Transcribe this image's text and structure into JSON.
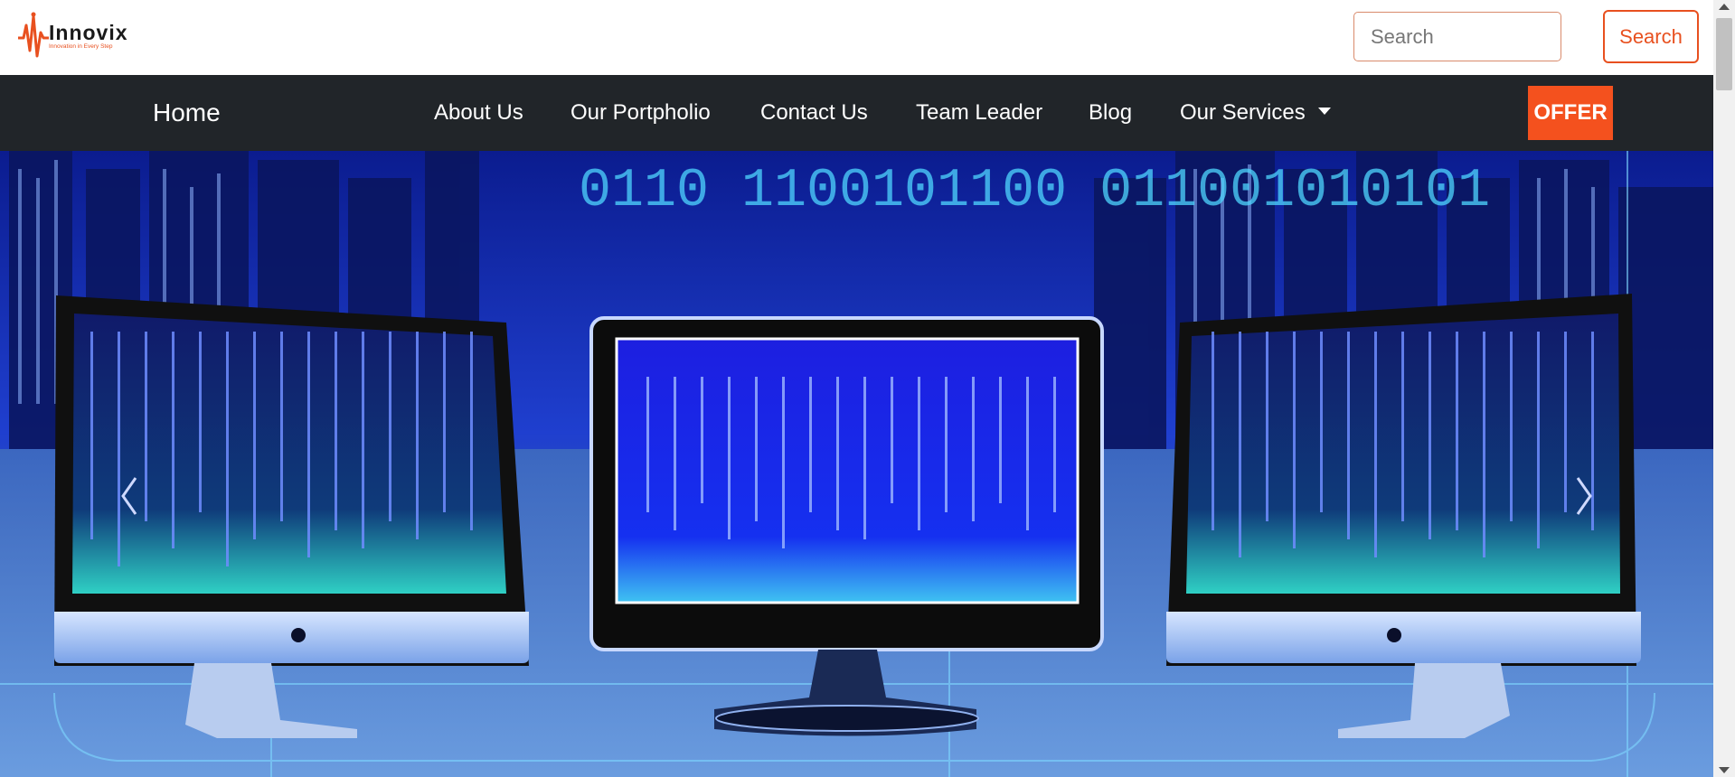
{
  "brand": {
    "name": "Innovix",
    "tagline": "Innovation in Every Step"
  },
  "search": {
    "placeholder": "Search",
    "button_label": "Search"
  },
  "nav": {
    "home": "Home",
    "items": [
      {
        "label": "About Us"
      },
      {
        "label": "Our Portpholio"
      },
      {
        "label": "Contact Us"
      },
      {
        "label": "Team Leader"
      },
      {
        "label": "Blog"
      },
      {
        "label": "Our Services"
      }
    ],
    "offer": "OFFER"
  },
  "carousel": {
    "prev_icon": "chevron-left-icon",
    "next_icon": "chevron-right-icon",
    "binary_text": "0110 1100101100 011001010101"
  },
  "colors": {
    "accent": "#f4511e",
    "navbar": "#212529"
  }
}
